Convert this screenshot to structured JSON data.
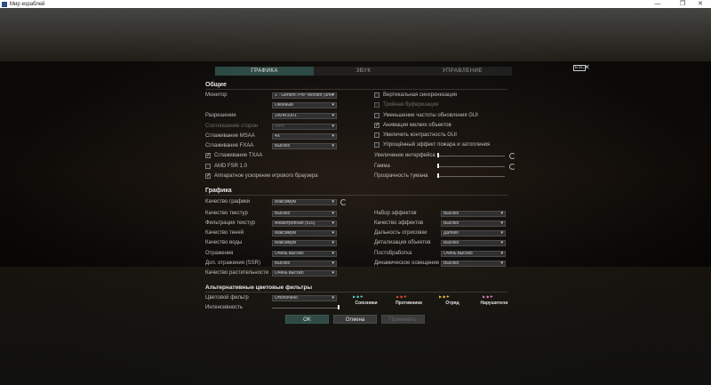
{
  "window": {
    "title": "Мир кораблей",
    "minimize": "—",
    "maximize": "❐",
    "close": "✕"
  },
  "tabs": [
    {
      "label": "ГРАФИКА",
      "active": true
    },
    {
      "label": "ЗВУК",
      "active": false
    },
    {
      "label": "УПРАВЛЕНИЕ",
      "active": false
    }
  ],
  "header": {
    "esc": "ESC",
    "close": "✕"
  },
  "general": {
    "title": "Общие",
    "monitor_label": "Монитор",
    "monitor_value": "1 - Generic PnP Monitor (элн",
    "window_mode_value": "Оконный",
    "resolution_label": "Разрешение",
    "resolution_value": "1904x1001",
    "aspect_label": "Соотношение сторон",
    "aspect_value": "Авто",
    "msaa_label": "Сглаживание MSAA",
    "msaa_value": "4X",
    "fxaa_label": "Сглаживание FXAA",
    "fxaa_value": "Высоко",
    "txaa_label": "Сглаживание TXAA",
    "fsr_label": "AMD FSR 1.0",
    "browser_label": "Аппаратное ускорение игрового браузера",
    "vsync_label": "Вертикальная синхронизация",
    "triple_label": "Тройная буферизация",
    "gui_rate_label": "Уменьшение частоты обновления GUI",
    "anim_label": "Анимация мелких объектов",
    "contrast_label": "Увеличить контрастность GUI",
    "fire_label": "Упрощённый эффект пожара и затопления",
    "ui_scale_label": "Увеличение интерфейса",
    "gamma_label": "Гамма",
    "fog_label": "Прозрачность тумана"
  },
  "graphics": {
    "title": "Графика",
    "quality_label": "Качество графики",
    "quality_value": "Максимум",
    "texture_label": "Качество текстур",
    "texture_value": "Высоко",
    "filter_label": "Фильтрация текстур",
    "filter_value": "Анизотропная (x16)",
    "shadow_label": "Качество теней",
    "shadow_value": "Максимум",
    "water_label": "Качество воды",
    "water_value": "Максимум",
    "reflect_label": "Отражения",
    "reflect_value": "Очень высоко",
    "ssr_label": "Доп. отражения (SSR)",
    "ssr_value": "Высоко",
    "veg_label": "Качество растительности",
    "veg_value": "Очень высоко",
    "fxset_label": "Набор эффектов",
    "fxset_value": "Высоко",
    "fxq_label": "Качество эффектов",
    "fxq_value": "Высоко",
    "draw_label": "Дальность отрисовки",
    "draw_value": "Далеко",
    "detail_label": "Детализация объектов",
    "detail_value": "Высоко",
    "post_label": "Постобработка",
    "post_value": "Очень высоко",
    "light_label": "Динамическое освещение",
    "light_value": "Высоко"
  },
  "color_filters": {
    "title": "Альтернативные цветовые фильтры",
    "filter_label": "Цветовой фильтр",
    "filter_value": "Отключено",
    "intensity_label": "Интенсивность",
    "allies": "Союзники",
    "enemies": "Противники",
    "squad": "Отряд",
    "violators": "Нарушители",
    "icon_text": "▶◆✚",
    "allies_color": "#5fd0c0",
    "enemies_color": "#e05030",
    "squad_color": "#e0c040",
    "violators_color": "#e080c0"
  },
  "buttons": {
    "ok": "OK",
    "cancel": "Отмена",
    "apply": "Применить"
  },
  "state": {
    "ui_scale_level": 0.0,
    "gamma_level": 0.0,
    "fog_level": 0.0,
    "intensity_level": 1.0
  }
}
